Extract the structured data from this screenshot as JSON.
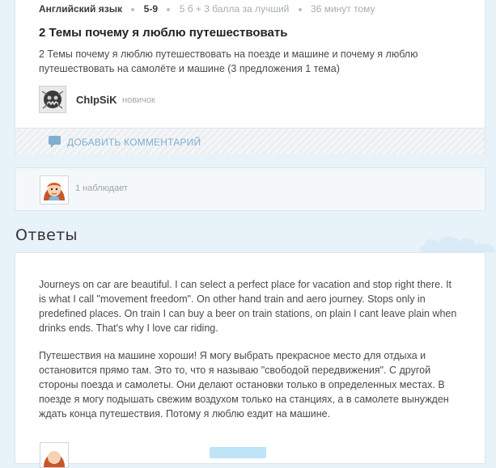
{
  "question": {
    "subject": "Английский язык",
    "grade": "5-9",
    "points": "5 б + 3 балла за лучший",
    "time": "36 минут тому",
    "title": "2 Темы почему я люблю путешествовать",
    "body": "2 Темы почему я люблю путешествовать на поезде и машине и почему я люблю путешествовать на самолёте и машине (3 предложения 1 тема)",
    "author_name": "ChIpSiK",
    "author_rank": "новичок",
    "comment_label": "ДОБАВИТЬ КОММЕНТАРИЙ"
  },
  "watchers": {
    "count_text": "1 наблюдает"
  },
  "answers": {
    "heading": "Ответы",
    "items": [
      {
        "paragraphs": [
          "Journeys on car are beautiful. I can select a perfect place for vacation and stop right there. It is what I call \"movement freedom\". On other hand train and aero journey. Stops only in predefined places. On train I can  buy a beer on train stations, on plain I cant leave plain when drinks ends. That's why I love car riding.",
          "Путешествия на машине хороши! Я могу выбрать прекрасное место для отдыха и остановится прямо там. Это то, что я называю \"свободой передвижения\". С другой стороны поезда и самолеты. Они делают остановки только в определенных местах. В поезде я могу подышать свежим воздухом только на станциях, а в самолете вынужден ждать конца путешествия. Потому я люблю ездит на машине."
        ]
      }
    ]
  },
  "colors": {
    "page_bg": "#e8f2f9",
    "link": "#7faed1",
    "text": "#4a4a4a"
  }
}
